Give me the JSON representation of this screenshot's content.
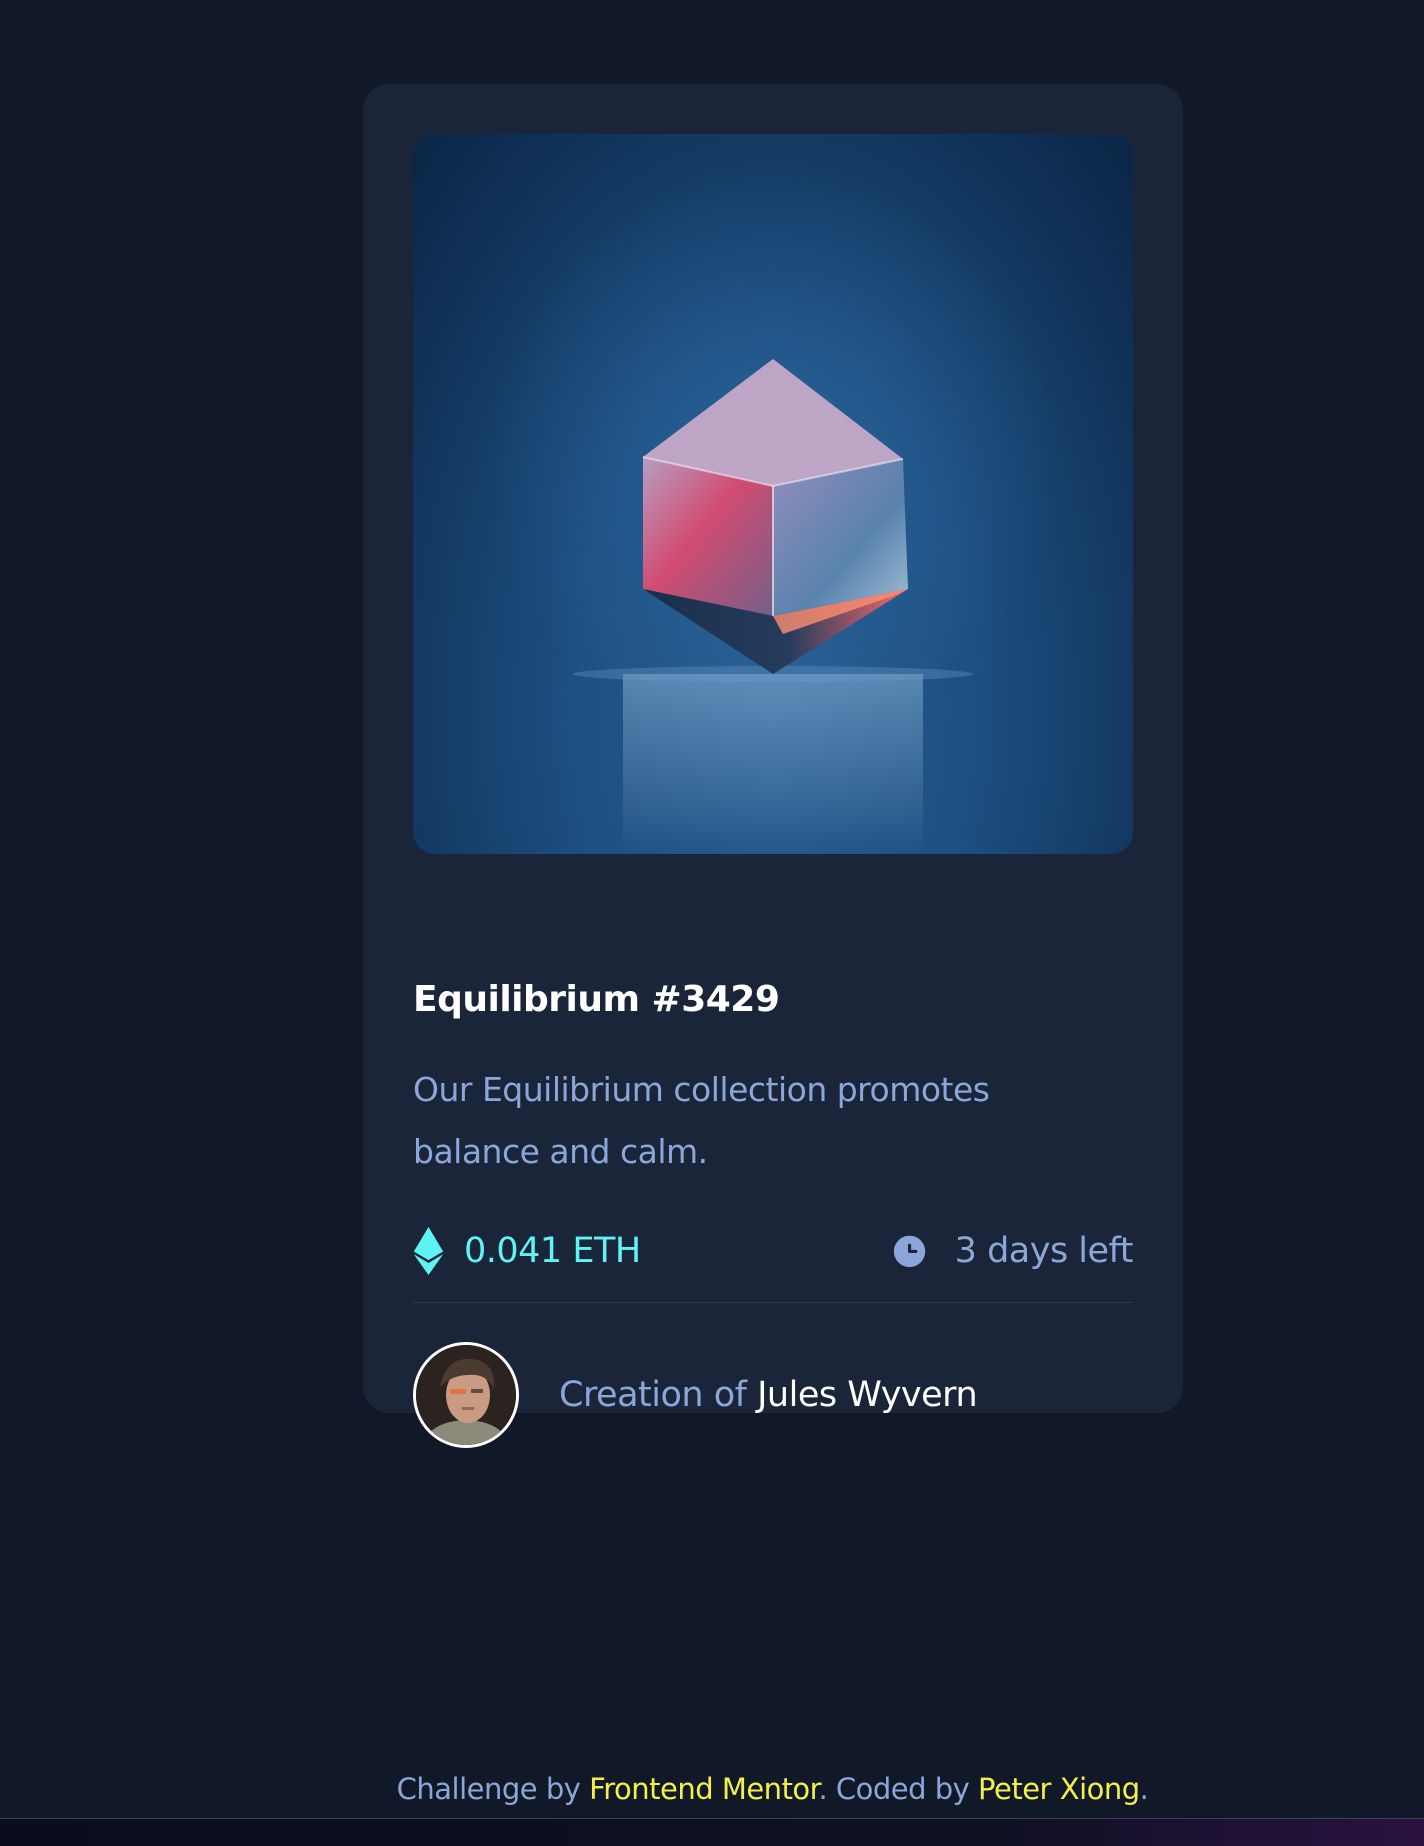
{
  "card": {
    "title": "Equilibrium #3429",
    "description": "Our Equilibrium collection promotes balance and calm.",
    "price": "0.041 ETH",
    "time_left": "3 days left",
    "creator_prefix": "Creation of",
    "creator_name": "Jules Wyvern"
  },
  "icons": {
    "price": "ethereum-icon",
    "time": "clock-icon"
  },
  "footer": {
    "challenge_prefix": "Challenge by",
    "challenge_link": "Frontend Mentor",
    "coded_prefix": ". Coded by",
    "coded_link": "Peter Xiong",
    "suffix": "."
  },
  "colors": {
    "page_background": "#111827",
    "card_background": "#1b2539",
    "accent_cyan": "#5ff4f4",
    "muted_blue": "#8ba6d8",
    "link_yellow": "#f3f04a"
  }
}
